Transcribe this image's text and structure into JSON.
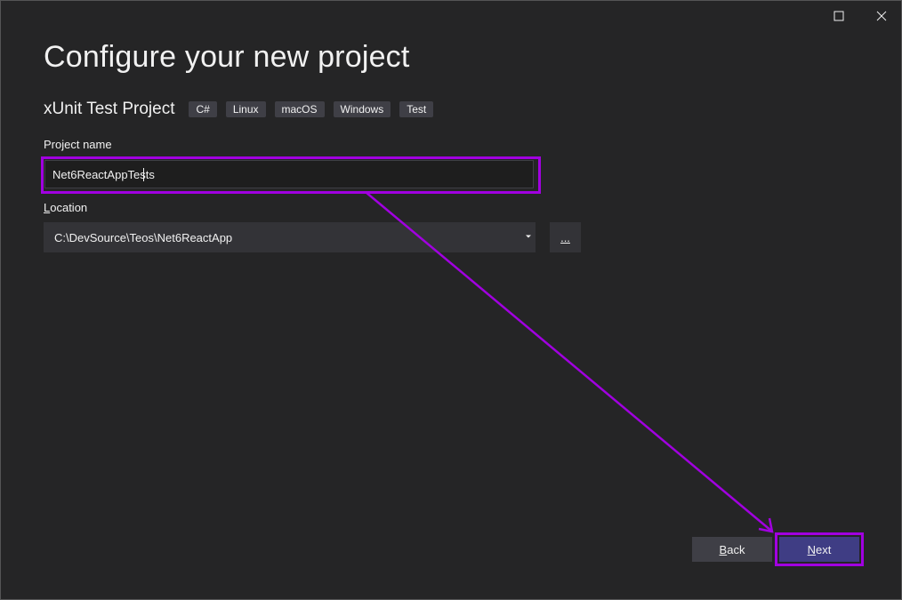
{
  "window": {
    "maximize_icon": "maximize-icon",
    "close_icon": "close-icon"
  },
  "header": {
    "title": "Configure your new project"
  },
  "template": {
    "name": "xUnit Test Project",
    "tags": [
      "C#",
      "Linux",
      "macOS",
      "Windows",
      "Test"
    ]
  },
  "project_name": {
    "label": "Project name",
    "value": "Net6ReactAppTests"
  },
  "location": {
    "label_access_key": "L",
    "label_rest": "ocation",
    "value": "C:\\DevSource\\Teos\\Net6ReactApp",
    "browse_label": "..."
  },
  "footer": {
    "back_access_key": "B",
    "back_rest": "ack",
    "next_access_key": "N",
    "next_rest": "ext"
  },
  "colors": {
    "background": "#252526",
    "highlight": "#a100e0",
    "next_button": "#3f3d84",
    "back_button": "#3f3f46"
  }
}
